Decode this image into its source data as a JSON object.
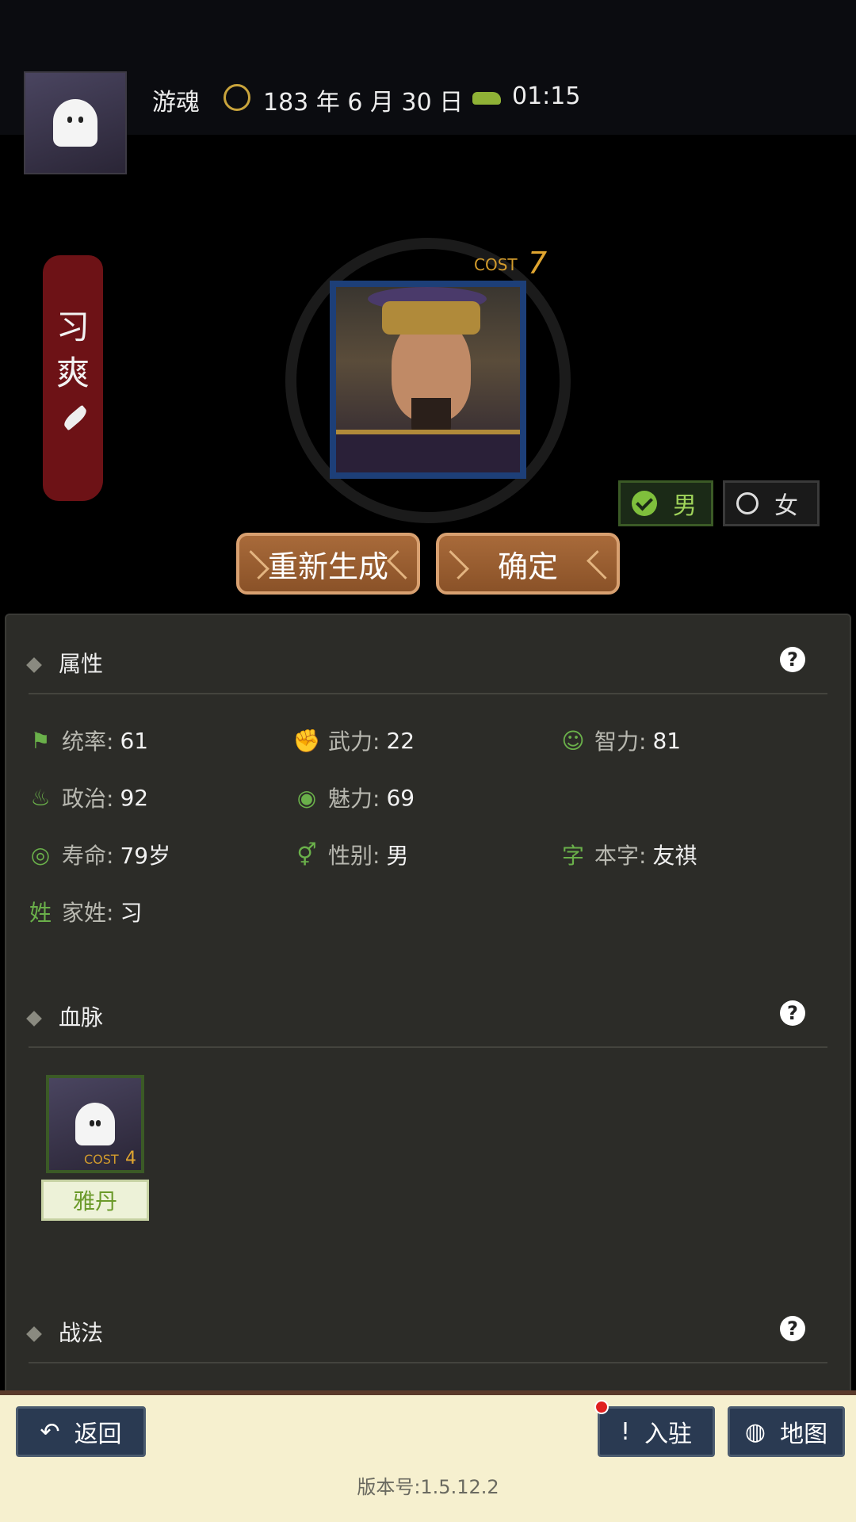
{
  "header": {
    "player_name": "游魂",
    "date": "183 年 6 月 30 日",
    "time": "01:15"
  },
  "character": {
    "name_chars": [
      "习",
      "爽"
    ],
    "cost_label": "COST",
    "cost_value": "7",
    "gender_options": [
      {
        "label": "男",
        "selected": true
      },
      {
        "label": "女",
        "selected": false
      }
    ]
  },
  "actions": {
    "regenerate": "重新生成",
    "confirm": "确定"
  },
  "attributes": {
    "title": "属性",
    "help": "?",
    "items": [
      {
        "key": "统率:",
        "value": "61",
        "icon": "flag-icon"
      },
      {
        "key": "武力:",
        "value": "22",
        "icon": "arm-icon"
      },
      {
        "key": "智力:",
        "value": "81",
        "icon": "brain-icon"
      },
      {
        "key": "政治:",
        "value": "92",
        "icon": "pot-icon"
      },
      {
        "key": "魅力:",
        "value": "69",
        "icon": "eye-icon"
      },
      {
        "key": "寿命:",
        "value": "79岁",
        "icon": "lifespan-icon"
      },
      {
        "key": "性别:",
        "value": "男",
        "icon": "gender-icon"
      },
      {
        "key": "本字:",
        "value": "友祺",
        "icon_char": "字"
      },
      {
        "key": "家姓:",
        "value": "习",
        "icon_char": "姓"
      }
    ]
  },
  "lineage": {
    "title": "血脉",
    "help": "?",
    "card": {
      "cost_label": "COST",
      "cost_value": "4",
      "name": "雅丹"
    }
  },
  "tactics": {
    "title": "战法",
    "help": "?"
  },
  "nav": {
    "back": "返回",
    "station": "入驻",
    "map": "地图",
    "station_mark": "!"
  },
  "version": "版本号:1.5.12.2",
  "colors": {
    "banner": "#6d1216",
    "accent_green": "#6ab04a",
    "button_brown": "#9a5e30",
    "nav_blue": "#2a3a52"
  }
}
